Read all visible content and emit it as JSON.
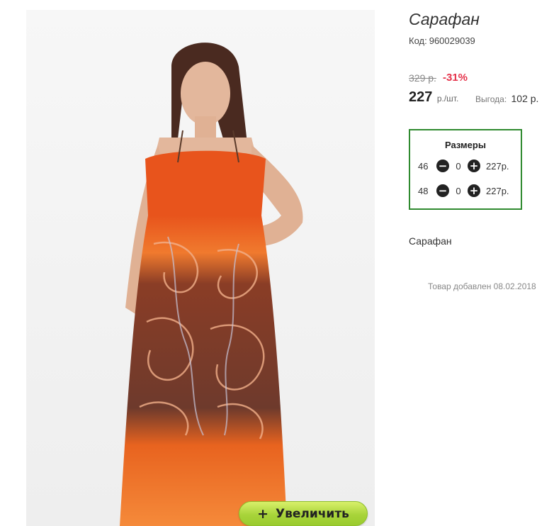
{
  "product": {
    "title": "Сарафан",
    "code_label": "Код:",
    "code": "960029039",
    "old_price": "329 р.",
    "discount": "-31%",
    "price": "227",
    "price_unit": "р./шт.",
    "savings_label": "Выгода:",
    "savings_value": "102 р.",
    "description": "Сарафан",
    "added_text": "Товар добавлен 08.02.2018"
  },
  "sizes": {
    "title": "Размеры",
    "rows": [
      {
        "size": "46",
        "qty": "0",
        "price": "227р."
      },
      {
        "size": "48",
        "qty": "0",
        "price": "227р."
      }
    ]
  },
  "gallery": {
    "zoom_icon": "plus-icon",
    "zoom_symbol": "+",
    "zoom_label": "Увеличить"
  },
  "colors": {
    "discount": "#e5334b",
    "sizes_border": "#2f8a2f",
    "zoom_button": "#b5dc42"
  }
}
